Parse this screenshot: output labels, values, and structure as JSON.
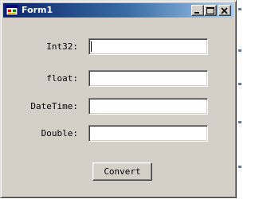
{
  "window": {
    "title": "Form1",
    "icon": "app-form-icon",
    "controls": {
      "minimize_icon": "minimize-icon",
      "maximize_icon": "maximize-icon",
      "close_icon": "close-icon"
    }
  },
  "form": {
    "fields": [
      {
        "label": "Int32:",
        "value": ""
      },
      {
        "label": "float:",
        "value": ""
      },
      {
        "label": "DateTime:",
        "value": ""
      },
      {
        "label": "Double:",
        "value": ""
      }
    ],
    "convert_label": "Convert"
  },
  "colors": {
    "face": "#d4d0c8",
    "title_start": "#0a246a",
    "title_end": "#a6caf0"
  }
}
